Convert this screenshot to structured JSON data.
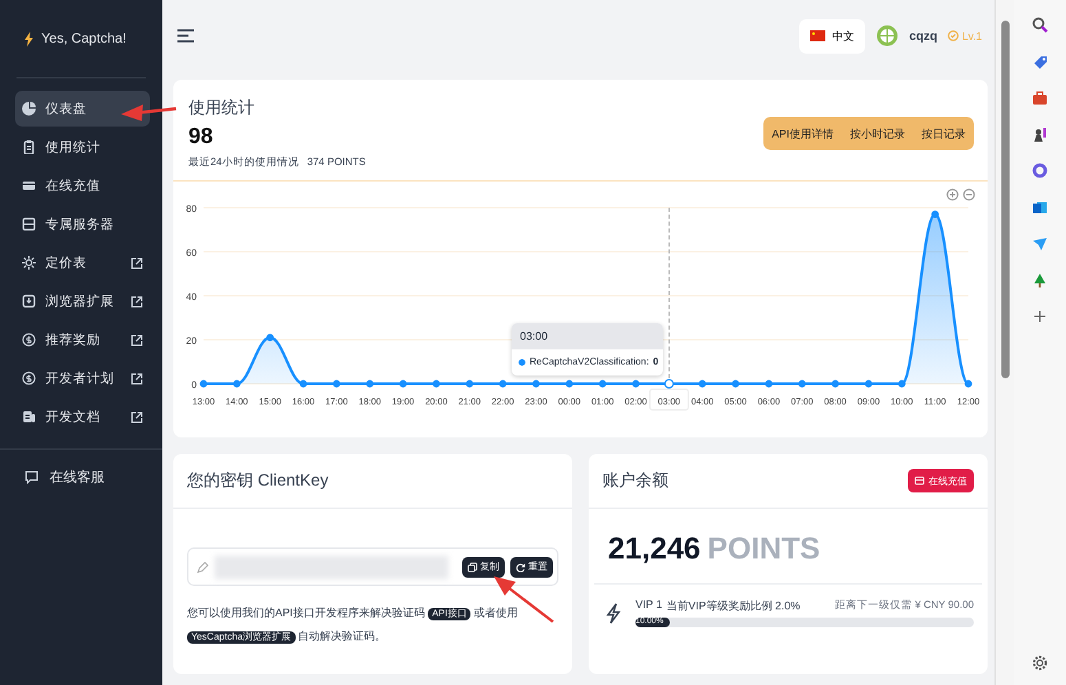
{
  "sidebar": {
    "logo": "Yes, Captcha!",
    "items": [
      {
        "label": "仪表盘",
        "external": false,
        "selected": true
      },
      {
        "label": "使用统计",
        "external": false,
        "selected": false
      },
      {
        "label": "在线充值",
        "external": false,
        "selected": false
      },
      {
        "label": "专属服务器",
        "external": false,
        "selected": false
      },
      {
        "label": "定价表",
        "external": true,
        "selected": false
      },
      {
        "label": "浏览器扩展",
        "external": true,
        "selected": false
      },
      {
        "label": "推荐奖励",
        "external": true,
        "selected": false
      },
      {
        "label": "开发者计划",
        "external": true,
        "selected": false
      },
      {
        "label": "开发文档",
        "external": true,
        "selected": false
      }
    ],
    "footer_item": {
      "label": "在线客服"
    }
  },
  "header": {
    "language": "中文",
    "username": "cqzq",
    "level": "Lv.1"
  },
  "usage": {
    "title": "使用统计",
    "total": "98",
    "subtitle": "最近24小时的使用情况",
    "points": "374 POINTS",
    "buttons": [
      "API使用详情",
      "按小时记录",
      "按日记录"
    ],
    "chart_data": {
      "type": "area",
      "categories": [
        "13:00",
        "14:00",
        "15:00",
        "16:00",
        "17:00",
        "18:00",
        "19:00",
        "20:00",
        "21:00",
        "22:00",
        "23:00",
        "00:00",
        "01:00",
        "02:00",
        "03:00",
        "04:00",
        "05:00",
        "06:00",
        "07:00",
        "08:00",
        "09:00",
        "10:00",
        "11:00",
        "12:00"
      ],
      "series": [
        {
          "color": "#1890ff",
          "values": [
            0,
            0,
            21,
            0,
            0,
            0,
            0,
            0,
            0,
            0,
            0,
            0,
            0,
            0,
            0,
            0,
            0,
            0,
            0,
            0,
            0,
            0,
            77,
            0
          ]
        }
      ],
      "ylim": [
        0,
        80
      ],
      "yticks": [
        0,
        20,
        40,
        60,
        80
      ],
      "grid": true
    },
    "tooltip": {
      "title": "03:00",
      "series": "ReCaptchaV2Classification:",
      "value": "0"
    }
  },
  "client_key": {
    "title": "您的密钥 ClientKey",
    "buttons": [
      {
        "label": "复制"
      },
      {
        "label": "重置"
      }
    ],
    "description": [
      {
        "kind": "text",
        "text": "您可以使用我们的API接口开发程序来解决验证码 "
      },
      {
        "kind": "badge",
        "text": "API接口"
      },
      {
        "kind": "text",
        "text": " 或者使用 "
      },
      {
        "kind": "badge",
        "text": "YesCaptcha浏览器扩展"
      },
      {
        "kind": "text",
        "text": " 自动解决验证码。"
      }
    ]
  },
  "balance": {
    "title": "账户余额",
    "recharge": "在线充值",
    "amount": "21,246",
    "unit": "POINTS",
    "vip": "VIP 1",
    "vip_text": "当前VIP等级奖励比例 2.0%",
    "next_level": "距离下一级仅需 ¥ CNY 90.00",
    "progress": {
      "level": 0.1,
      "label": "10.00%"
    }
  }
}
